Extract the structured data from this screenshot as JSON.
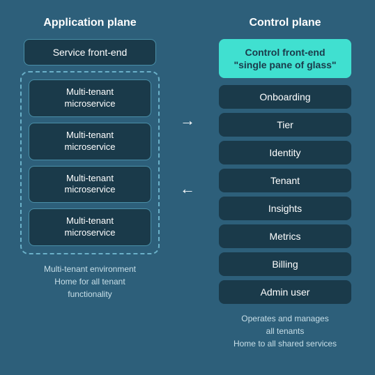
{
  "app_plane": {
    "title": "Application plane",
    "service_frontend": "Service front-end",
    "microservices": [
      {
        "label": "Multi-tenant\nmicroservice"
      },
      {
        "label": "Multi-tenant\nmicroservice"
      },
      {
        "label": "Multi-tenant\nmicroservice"
      },
      {
        "label": "Multi-tenant\nmicroservice"
      }
    ],
    "footnote_line1": "Multi-tenant environment",
    "footnote_line2": "Home for all tenant",
    "footnote_line3": "functionality"
  },
  "control_plane": {
    "title": "Control plane",
    "frontend_line1": "Control front-end",
    "frontend_line2": "\"single pane of glass\"",
    "services": [
      "Onboarding",
      "Tier",
      "Identity",
      "Tenant",
      "Insights",
      "Metrics",
      "Billing",
      "Admin user"
    ],
    "footnote_line1": "Operates and manages",
    "footnote_line2": "all tenants",
    "footnote_line3": "Home to all shared services"
  },
  "arrows": {
    "right_arrow": "→",
    "left_arrow": "←"
  }
}
